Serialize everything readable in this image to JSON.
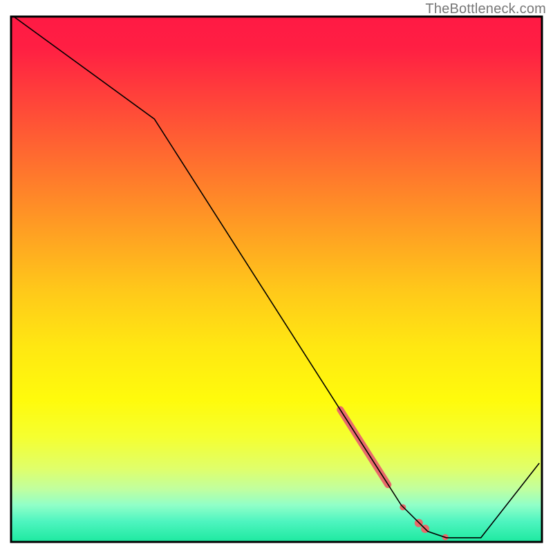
{
  "attribution": "TheBottleneck.com",
  "chart_data": {
    "type": "line",
    "title": "",
    "xlabel": "",
    "ylabel": "",
    "xlim": [
      0,
      100
    ],
    "ylim": [
      0,
      100
    ],
    "background_gradient": {
      "stops": [
        {
          "pos": 0.0,
          "color": "#ff1a44"
        },
        {
          "pos": 0.06,
          "color": "#ff1f43"
        },
        {
          "pos": 0.22,
          "color": "#ff5a34"
        },
        {
          "pos": 0.38,
          "color": "#ff9525"
        },
        {
          "pos": 0.52,
          "color": "#ffc81a"
        },
        {
          "pos": 0.63,
          "color": "#ffe812"
        },
        {
          "pos": 0.73,
          "color": "#fffb0c"
        },
        {
          "pos": 0.8,
          "color": "#f5ff30"
        },
        {
          "pos": 0.86,
          "color": "#e0ff6a"
        },
        {
          "pos": 0.9,
          "color": "#c0ffa0"
        },
        {
          "pos": 0.93,
          "color": "#90ffc8"
        },
        {
          "pos": 0.96,
          "color": "#50f5c0"
        },
        {
          "pos": 1.0,
          "color": "#1de9a0"
        }
      ]
    },
    "series": [
      {
        "name": "curve",
        "color": "#000000",
        "width": 1.6,
        "points": [
          {
            "x": 0.5,
            "y": 100
          },
          {
            "x": 27,
            "y": 80.5
          },
          {
            "x": 73.5,
            "y": 7
          },
          {
            "x": 78.5,
            "y": 2
          },
          {
            "x": 82,
            "y": 0.8
          },
          {
            "x": 88.5,
            "y": 0.8
          },
          {
            "x": 99.5,
            "y": 15
          }
        ]
      }
    ],
    "markers": {
      "color": "#e86a6a",
      "thick_segment": {
        "start": {
          "x": 62,
          "y": 25.2
        },
        "end": {
          "x": 71,
          "y": 10.9
        },
        "width": 10
      },
      "points": [
        {
          "x": 73.8,
          "y": 6.6,
          "r": 4.5
        },
        {
          "x": 76.8,
          "y": 3.6,
          "r": 6
        },
        {
          "x": 78.0,
          "y": 2.5,
          "r": 6
        },
        {
          "x": 81.8,
          "y": 0.9,
          "r": 4.5
        }
      ]
    },
    "frame": {
      "color": "#000000",
      "width": 3
    }
  }
}
